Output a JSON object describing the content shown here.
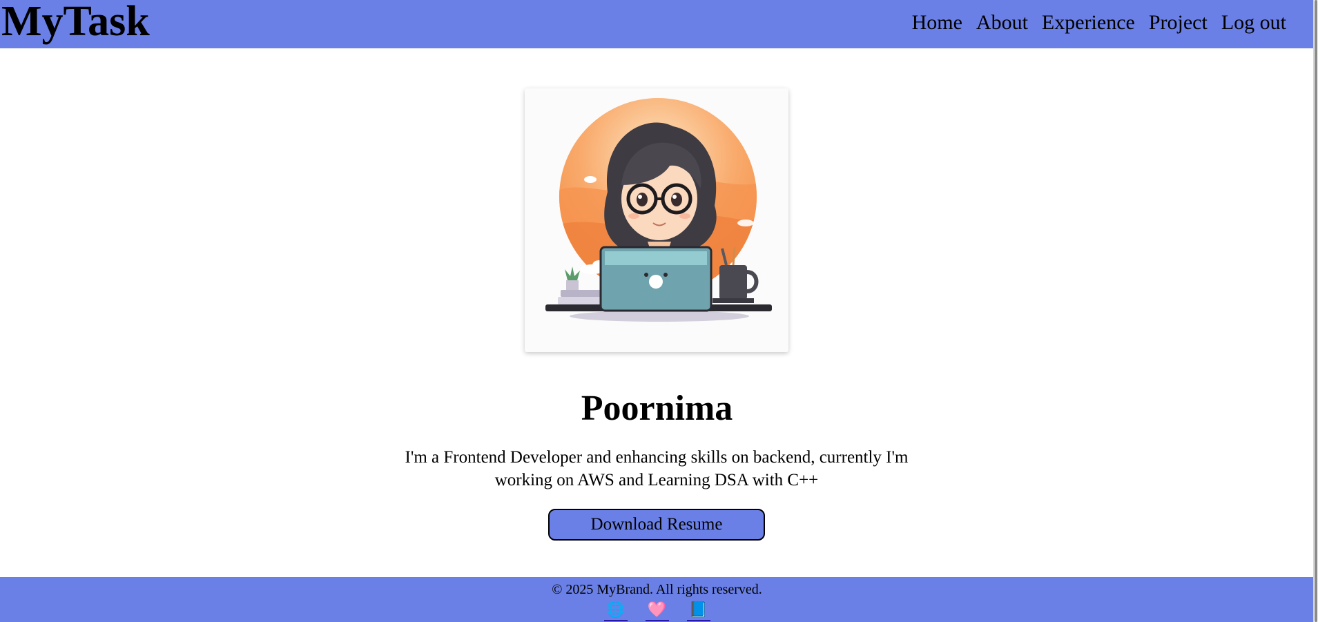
{
  "header": {
    "brand": "MyTask",
    "nav": [
      {
        "label": "Home"
      },
      {
        "label": "About"
      },
      {
        "label": "Experience"
      },
      {
        "label": "Project"
      },
      {
        "label": "Log out"
      }
    ]
  },
  "hero": {
    "name": "Poornima",
    "bio": "I'm a Frontend Developer and enhancing skills on backend, currently I'm working on AWS and Learning DSA with C++",
    "resume_button": "Download Resume"
  },
  "footer": {
    "copyright": "© 2025 MyBrand. All rights reserved.",
    "social_icons": [
      "globe-icon",
      "heart-icon",
      "book-icon"
    ]
  },
  "colors": {
    "accent": "#6a80e6",
    "background": "#ffffff"
  }
}
